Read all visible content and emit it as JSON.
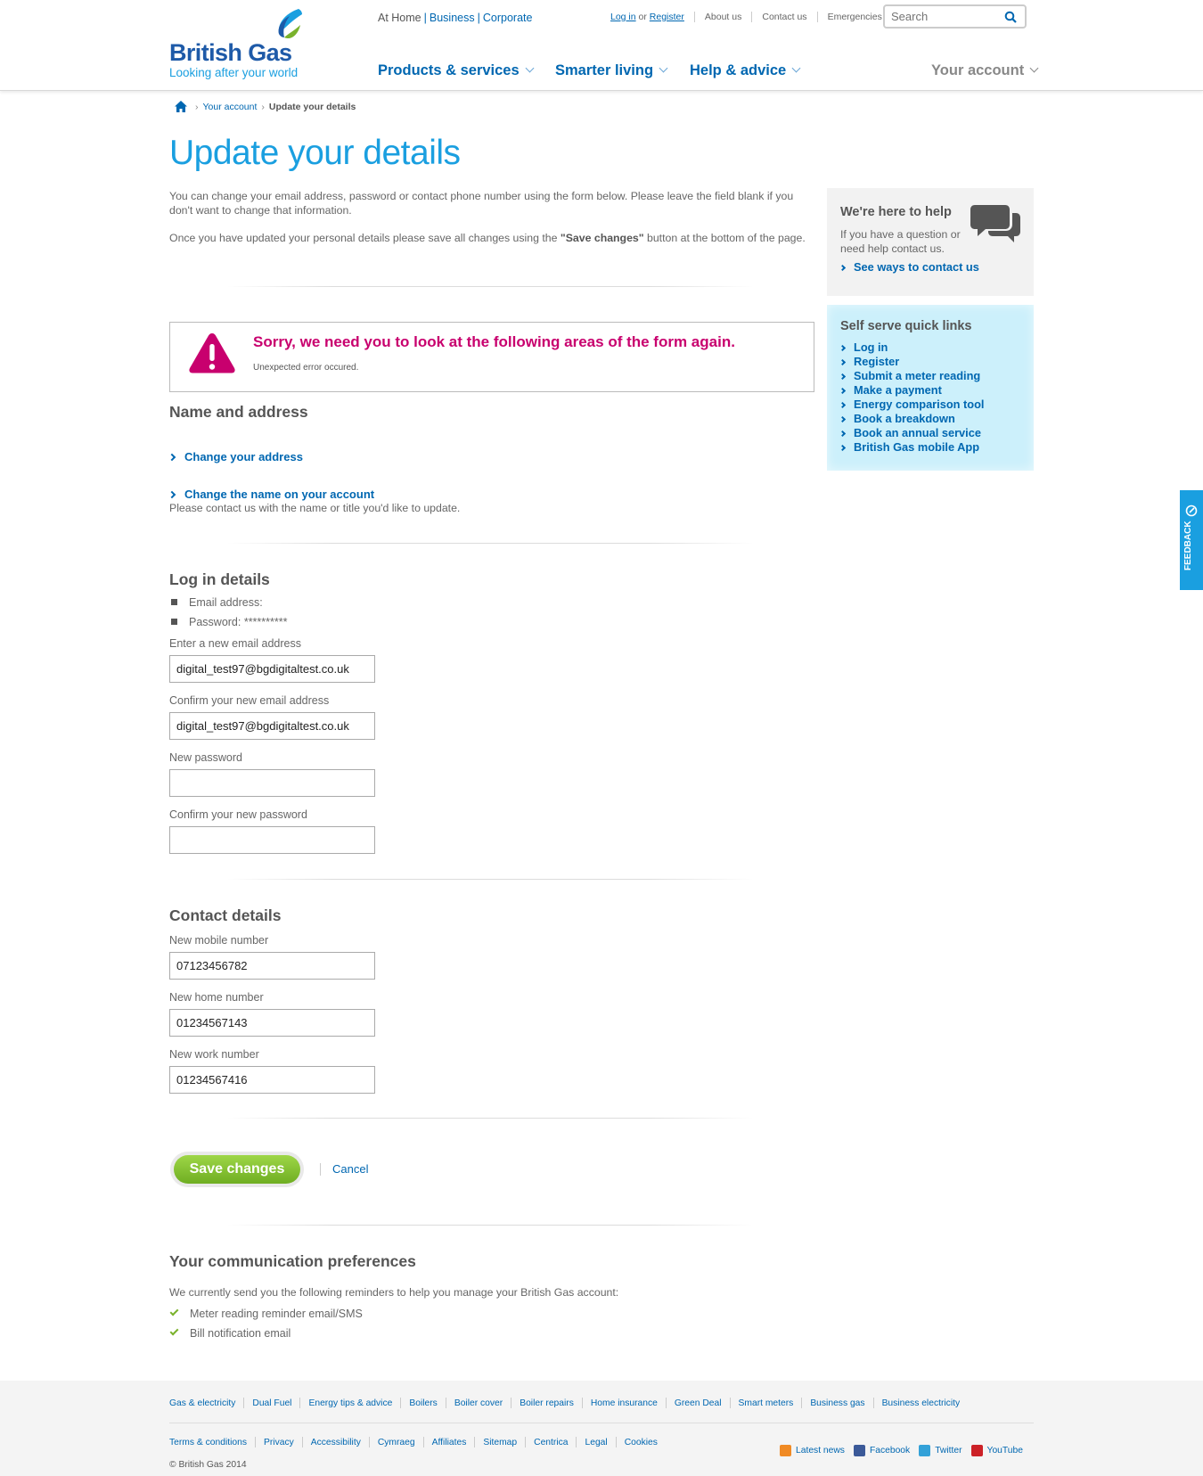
{
  "header": {
    "logo_name": "British Gas",
    "logo_tagline": "Looking after your world",
    "sectors": {
      "current": "At Home",
      "business": "Business",
      "corporate": "Corporate"
    },
    "toplinks": {
      "login": "Log in",
      "or": "or",
      "register": "Register",
      "about": "About us",
      "contact": "Contact us",
      "emergencies": "Emergencies"
    },
    "search_placeholder": "Search",
    "nav": [
      "Products & services",
      "Smarter living",
      "Help & advice"
    ],
    "account": "Your account"
  },
  "breadcrumb": {
    "parent": "Your account",
    "current": "Update your details"
  },
  "page_title": "Update your details",
  "intro": {
    "p1": "You can change your email address, password or contact phone number using the form below. Please leave the field blank if you don't want to change that information.",
    "p2_before": "Once you have updated your personal details please save all changes using the ",
    "p2_bold": "\"Save changes\"",
    "p2_after": " button at the bottom of the page."
  },
  "error": {
    "title": "Sorry, we need you to look at the following areas of the form again.",
    "message": "Unexpected error occured."
  },
  "name_address": {
    "heading": "Name and address",
    "change_address": "Change your address",
    "change_name": "Change the name on your account",
    "name_note": "Please contact us with the name or title you'd like to update."
  },
  "login_details": {
    "heading": "Log in details",
    "email_label": "Email address:",
    "password_label": "Password: **********",
    "new_email_label": "Enter a new email address",
    "new_email_value": "digital_test97@bgdigitaltest.co.uk",
    "confirm_email_label": "Confirm your new email address",
    "confirm_email_value": "digital_test97@bgdigitaltest.co.uk",
    "new_password_label": "New password",
    "confirm_password_label": "Confirm your new password"
  },
  "contact_details": {
    "heading": "Contact details",
    "mobile_label": "New mobile number",
    "mobile_value": "07123456782",
    "home_label": "New home number",
    "home_value": "01234567143",
    "work_label": "New work number",
    "work_value": "01234567416"
  },
  "actions": {
    "save": "Save changes",
    "cancel": "Cancel"
  },
  "preferences": {
    "heading": "Your communication preferences",
    "intro": "We currently send you the following reminders to help you manage your British Gas account:",
    "items": [
      "Meter reading reminder email/SMS",
      "Bill notification email"
    ]
  },
  "help_panel": {
    "title": "We're here to help",
    "text": "If you have a question or need help contact us.",
    "link": "See ways to contact us"
  },
  "quick_links": {
    "title": "Self serve quick links",
    "items": [
      "Log in",
      "Register",
      "Submit a meter reading",
      "Make a payment",
      "Energy comparison tool",
      "Book a breakdown",
      "Book an annual service",
      "British Gas mobile App"
    ]
  },
  "feedback": "FEEDBACK",
  "footer": {
    "row1": [
      "Gas & electricity",
      "Dual Fuel",
      "Energy tips & advice",
      "Boilers",
      "Boiler cover",
      "Boiler repairs",
      "Home insurance",
      "Green Deal",
      "Smart meters",
      "Business gas",
      "Business electricity"
    ],
    "row2": [
      "Terms & conditions",
      "Privacy",
      "Accessibility",
      "Cymraeg",
      "Affiliates",
      "Sitemap",
      "Centrica",
      "Legal",
      "Cookies"
    ],
    "social": [
      "Latest news",
      "Facebook",
      "Twitter",
      "YouTube"
    ],
    "copyright": "© British Gas 2014"
  },
  "colors": {
    "brand_blue": "#0067b1",
    "title_blue": "#1a9fe0",
    "error_magenta": "#c8006e",
    "save_green": "#7ab22c",
    "quick_bg": "#ccf0fb"
  }
}
